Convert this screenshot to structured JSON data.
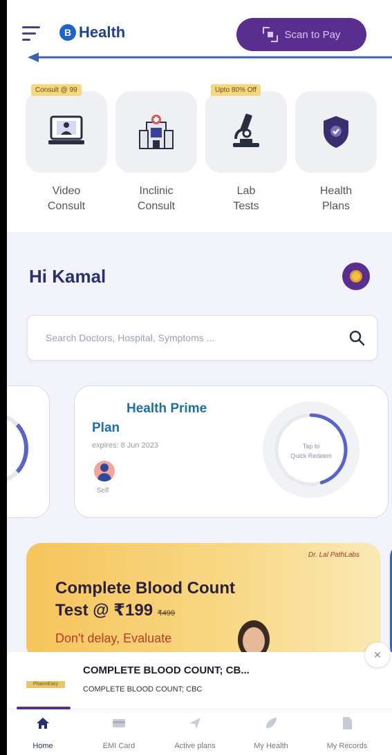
{
  "header": {
    "brand_initial": "B",
    "brand_name": "Health",
    "scan_label": "Scan to Pay"
  },
  "services": [
    {
      "id": "video",
      "badge": "Consult @ 99",
      "label_line1": "Video",
      "label_line2": "Consult",
      "icon": "video-consult-icon"
    },
    {
      "id": "inclinic",
      "badge": "",
      "label_line1": "Inclinic",
      "label_line2": "Consult",
      "icon": "hospital-icon"
    },
    {
      "id": "lab",
      "badge": "Upto 80% Off",
      "label_line1": "Lab",
      "label_line2": "Tests",
      "icon": "microscope-icon"
    },
    {
      "id": "plans",
      "badge": "",
      "label_line1": "Health",
      "label_line2": "Plans",
      "icon": "shield-icon"
    }
  ],
  "greeting": "Hi Kamal",
  "search": {
    "placeholder": "Search Doctors, Hospital, Symptoms ..."
  },
  "plan_card": {
    "title": "Health Prime",
    "subtitle": "Plan",
    "expiry": "expires: 8 Jun 2023",
    "member": "Self",
    "ring_text_line1": "Tap to",
    "ring_text_line2": "Quick Redeem",
    "ring_progress": 0.45
  },
  "promo": {
    "lab_tag": "Dr. Lal PathLabs",
    "title_line1": "Complete Blood Count",
    "title_line2": "Test @ ₹199",
    "old_price": "₹499",
    "subtitle": "Don't delay, Evaluate"
  },
  "cart": {
    "badge": "PharmEasy",
    "title": "COMPLETE BLOOD COUNT; CB...",
    "subtitle": "COMPLETE BLOOD COUNT; CBC",
    "close_symbol": "✕"
  },
  "bottom_nav": [
    {
      "id": "home",
      "label": "Home",
      "icon": "home-icon",
      "active": true
    },
    {
      "id": "emi",
      "label": "EMI Card",
      "icon": "card-icon",
      "active": false
    },
    {
      "id": "plans",
      "label": "Active plans",
      "icon": "send-icon",
      "active": false
    },
    {
      "id": "health",
      "label": "My Health",
      "icon": "leaf-icon",
      "active": false
    },
    {
      "id": "records",
      "label": "My Records",
      "icon": "document-icon",
      "active": false
    }
  ],
  "colors": {
    "brand_purple": "#5a2d91",
    "brand_blue": "#1e3f8a",
    "plan_blue": "#1e6ea8",
    "ring": "#5a63c9",
    "background": "#f3f4fb"
  }
}
